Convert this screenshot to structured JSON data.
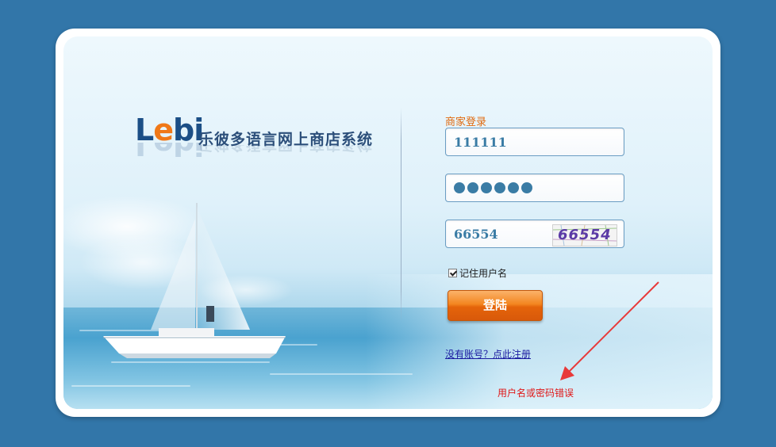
{
  "brand": {
    "logo_prefix": "L",
    "logo_e": "e",
    "logo_suffix": "bi",
    "subtitle": "乐彼多语言网上商店系统"
  },
  "form": {
    "title": "商家登录",
    "username_value": "111111",
    "password_length": 6,
    "captcha_value": "66554",
    "captcha_image_text": "66554",
    "remember_label": "记住用户名",
    "remember_checked": true,
    "login_button": "登陆",
    "register_link": "没有账号？点此注册",
    "error_message": "用户名或密码错误"
  },
  "colors": {
    "page_background": "#3276a9",
    "accent_orange": "#f38620",
    "error_red": "#e01818",
    "logo_blue": "#1b4e86"
  },
  "icons": {
    "annotation_arrow": "red-arrow-icon",
    "remember_checkbox": "checkbox-checked-icon"
  }
}
